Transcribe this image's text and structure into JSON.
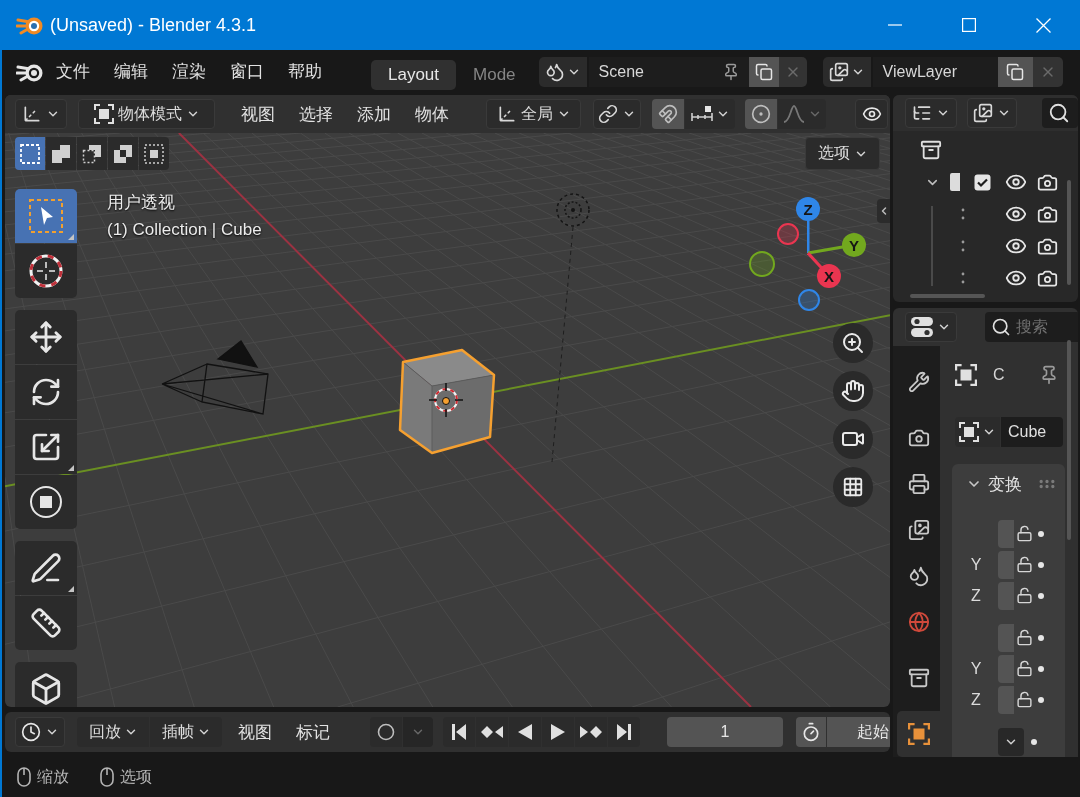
{
  "window": {
    "title": "(Unsaved) - Blender 4.3.1"
  },
  "top_bar": {
    "menus": [
      "文件",
      "编辑",
      "渲染",
      "窗口",
      "帮助"
    ],
    "workspaces": [
      {
        "label": "Layout",
        "selected": true
      },
      {
        "label": "Mode",
        "selected": false
      }
    ],
    "scene": "Scene",
    "view_layer": "ViewLayer"
  },
  "viewport": {
    "header": {
      "mode": "物体模式",
      "menus": [
        "视图",
        "选择",
        "添加",
        "物体"
      ],
      "orientation": "全局",
      "snap": {
        "on": false
      },
      "proportional_edit": {
        "on": false
      }
    },
    "select_modes": [
      {
        "kind": "set",
        "selected": true
      },
      {
        "kind": "extend",
        "selected": false
      },
      {
        "kind": "subtract",
        "selected": false
      },
      {
        "kind": "invert",
        "selected": false
      },
      {
        "kind": "intersect",
        "selected": false
      }
    ],
    "options": "选项",
    "tool_groups": [
      {
        "tools": [
          {
            "kind": "select_box",
            "selected": true,
            "submenu": true
          },
          {
            "kind": "cursor",
            "selected": false,
            "submenu": false
          }
        ]
      },
      {
        "tools": [
          {
            "kind": "move",
            "selected": false,
            "submenu": false
          },
          {
            "kind": "rotate",
            "selected": false,
            "submenu": false
          },
          {
            "kind": "scale",
            "selected": false,
            "submenu": true
          },
          {
            "kind": "transform",
            "selected": false,
            "submenu": false
          }
        ]
      },
      {
        "tools": [
          {
            "kind": "annotate",
            "selected": false,
            "submenu": true
          },
          {
            "kind": "measure",
            "selected": false,
            "submenu": false
          }
        ]
      },
      {
        "tools": [
          {
            "kind": "add_cube",
            "selected": false,
            "submenu": false
          }
        ]
      }
    ],
    "view_name": "用户透视",
    "info": "(1) Collection | Cube",
    "gizmo": {
      "axes": [
        {
          "label": "Z",
          "color": "#2f86e8"
        },
        {
          "label": "Y",
          "color": "#72a81e"
        },
        {
          "label": "X",
          "color": "#ea3550"
        }
      ]
    }
  },
  "outliner": {
    "tree": [
      {
        "kind": "scene_collection",
        "children": [
          {
            "kind": "collection",
            "expanded": true,
            "checked": true,
            "visible": true,
            "renderable": true,
            "children": [
              {
                "kind": "object",
                "visible": true,
                "renderable": true
              },
              {
                "kind": "object",
                "visible": true,
                "renderable": true
              },
              {
                "kind": "object",
                "visible": true,
                "renderable": true
              }
            ]
          }
        ]
      }
    ]
  },
  "properties": {
    "search": {
      "placeholder": "搜索"
    },
    "tab_groups": [
      {
        "tabs": [
          {
            "kind": "tool",
            "selected": false
          }
        ]
      },
      {
        "tabs": [
          {
            "kind": "render",
            "selected": false
          },
          {
            "kind": "output",
            "selected": false
          },
          {
            "kind": "view_layer",
            "selected": false
          },
          {
            "kind": "scene",
            "selected": false
          },
          {
            "kind": "world",
            "selected": false
          }
        ]
      },
      {
        "tabs": [
          {
            "kind": "collection",
            "selected": false
          }
        ]
      },
      {
        "tabs": [
          {
            "kind": "object",
            "selected": true
          }
        ]
      }
    ],
    "object_name": "C",
    "object_data": "Cube",
    "panel": {
      "title": "变换",
      "expanded": true,
      "groups": [
        {
          "rows": [
            {
              "kind": "lock",
              "locked": false
            },
            {
              "kind": "lock",
              "label": "Y",
              "locked": false
            },
            {
              "kind": "lock",
              "label": "Z",
              "locked": false
            }
          ]
        },
        {
          "rows": [
            {
              "kind": "lock",
              "locked": false
            },
            {
              "kind": "lock",
              "label": "Y",
              "locked": false
            },
            {
              "kind": "lock",
              "label": "Z",
              "locked": false
            }
          ]
        },
        {
          "rows": [
            {
              "kind": "dropdown"
            }
          ]
        }
      ]
    }
  },
  "timeline": {
    "menus": [
      {
        "label": "回放",
        "kind": "dropdown"
      },
      {
        "label": "插帧",
        "kind": "dropdown"
      },
      {
        "label": "视图",
        "kind": "plain"
      },
      {
        "label": "标记",
        "kind": "plain"
      }
    ],
    "auto_key": {
      "on": false
    },
    "current_frame": "1",
    "start": "起始"
  },
  "status_bar": {
    "hints": [
      "缩放",
      "选项"
    ]
  }
}
